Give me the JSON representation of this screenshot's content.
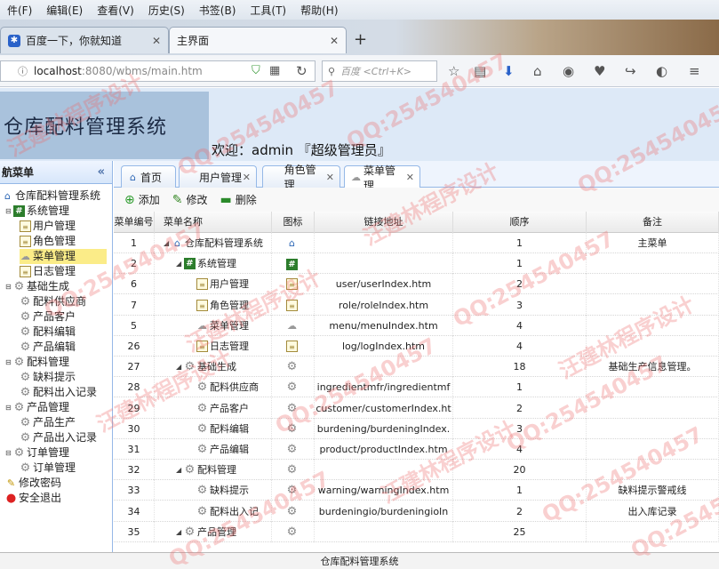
{
  "browser": {
    "menu": [
      "件(F)",
      "编辑(E)",
      "查看(V)",
      "历史(S)",
      "书签(B)",
      "工具(T)",
      "帮助(H)"
    ],
    "tabs": [
      {
        "title": "百度一下，你就知道"
      },
      {
        "title": "主界面"
      }
    ],
    "url_host": "localhost",
    "url_rest": ":8080/wbms/main.htm",
    "search_placeholder": "百度 <Ctrl+K>"
  },
  "app": {
    "title": "仓库配料管理系统",
    "welcome": "欢迎：admin 『超级管理员』",
    "footer": "仓库配料管理系统"
  },
  "nav": {
    "header": "航菜单",
    "items": [
      {
        "label": "仓库配料管理系统",
        "icon": "home-icon"
      },
      {
        "label": "系统管理",
        "icon": "hash-icon"
      },
      {
        "label": "用户管理",
        "icon": "page-icon"
      },
      {
        "label": "角色管理",
        "icon": "page-icon"
      },
      {
        "label": "菜单管理",
        "icon": "cloud-icon"
      },
      {
        "label": "日志管理",
        "icon": "page-icon"
      },
      {
        "label": "基础生成",
        "icon": "gear-icon"
      },
      {
        "label": "配料供应商",
        "icon": "gear-icon"
      },
      {
        "label": "产品客户",
        "icon": "gear-icon"
      },
      {
        "label": "配料编辑",
        "icon": "gear-icon"
      },
      {
        "label": "产品编辑",
        "icon": "gear-icon"
      },
      {
        "label": "配料管理",
        "icon": "gear-icon"
      },
      {
        "label": "缺料提示",
        "icon": "gear-icon"
      },
      {
        "label": "配料出入记录",
        "icon": "gear-icon"
      },
      {
        "label": "产品管理",
        "icon": "gear-icon"
      },
      {
        "label": "产品生产",
        "icon": "gear-icon"
      },
      {
        "label": "产品出入记录",
        "icon": "gear-icon"
      },
      {
        "label": "订单管理",
        "icon": "gear-icon"
      },
      {
        "label": "订单管理",
        "icon": "gear-icon"
      },
      {
        "label": "修改密码",
        "icon": "pen-icon"
      },
      {
        "label": "安全退出",
        "icon": "exit-icon"
      }
    ]
  },
  "content_tabs": [
    {
      "label": "首页",
      "closable": false
    },
    {
      "label": "用户管理",
      "closable": true
    },
    {
      "label": "角色管理",
      "closable": true
    },
    {
      "label": "菜单管理",
      "closable": true,
      "active": true
    }
  ],
  "toolbar": {
    "add": "添加",
    "edit": "修改",
    "delete": "删除"
  },
  "grid": {
    "headers": [
      "菜单编号",
      "菜单名称",
      "图标",
      "链接地址",
      "顺序",
      "备注"
    ],
    "rows": [
      {
        "id": "1",
        "name": "仓库配料管理系统",
        "icon": "home-icon",
        "url": "",
        "order": "1",
        "remark": "主菜单"
      },
      {
        "id": "2",
        "name": "系统管理",
        "icon": "hash-icon",
        "url": "",
        "order": "1",
        "remark": ""
      },
      {
        "id": "6",
        "name": "用户管理",
        "icon": "page-icon",
        "url": "user/userIndex.htm",
        "order": "2",
        "remark": ""
      },
      {
        "id": "7",
        "name": "角色管理",
        "icon": "page-icon",
        "url": "role/roleIndex.htm",
        "order": "3",
        "remark": ""
      },
      {
        "id": "5",
        "name": "菜单管理",
        "icon": "cloud-icon",
        "url": "menu/menuIndex.htm",
        "order": "4",
        "remark": ""
      },
      {
        "id": "26",
        "name": "日志管理",
        "icon": "page-icon",
        "url": "log/logIndex.htm",
        "order": "4",
        "remark": ""
      },
      {
        "id": "27",
        "name": "基础生成",
        "icon": "gear-icon",
        "url": "",
        "order": "18",
        "remark": "基础生产信息管理。"
      },
      {
        "id": "28",
        "name": "配料供应商",
        "icon": "gear-icon",
        "url": "ingredientmfr/ingredientmf",
        "order": "1",
        "remark": ""
      },
      {
        "id": "29",
        "name": "产品客户",
        "icon": "gear-icon",
        "url": "customer/customerIndex.ht",
        "order": "2",
        "remark": ""
      },
      {
        "id": "30",
        "name": "配料编辑",
        "icon": "gear-icon",
        "url": "burdening/burdeningIndex.",
        "order": "3",
        "remark": ""
      },
      {
        "id": "31",
        "name": "产品编辑",
        "icon": "gear-icon",
        "url": "product/productIndex.htm",
        "order": "4",
        "remark": ""
      },
      {
        "id": "32",
        "name": "配料管理",
        "icon": "gear-icon",
        "url": "",
        "order": "20",
        "remark": ""
      },
      {
        "id": "33",
        "name": "缺料提示",
        "icon": "gear-icon",
        "url": "warning/warningIndex.htm",
        "order": "1",
        "remark": "缺料提示警戒线"
      },
      {
        "id": "34",
        "name": "配料出入记",
        "icon": "gear-icon",
        "url": "burdeningio/burdeningioIn",
        "order": "2",
        "remark": "出入库记录"
      },
      {
        "id": "35",
        "name": "产品管理",
        "icon": "gear-icon",
        "url": "",
        "order": "25",
        "remark": ""
      }
    ]
  },
  "watermark": {
    "qq": "QQ:254540457",
    "cn": "汪建林程序设计"
  }
}
